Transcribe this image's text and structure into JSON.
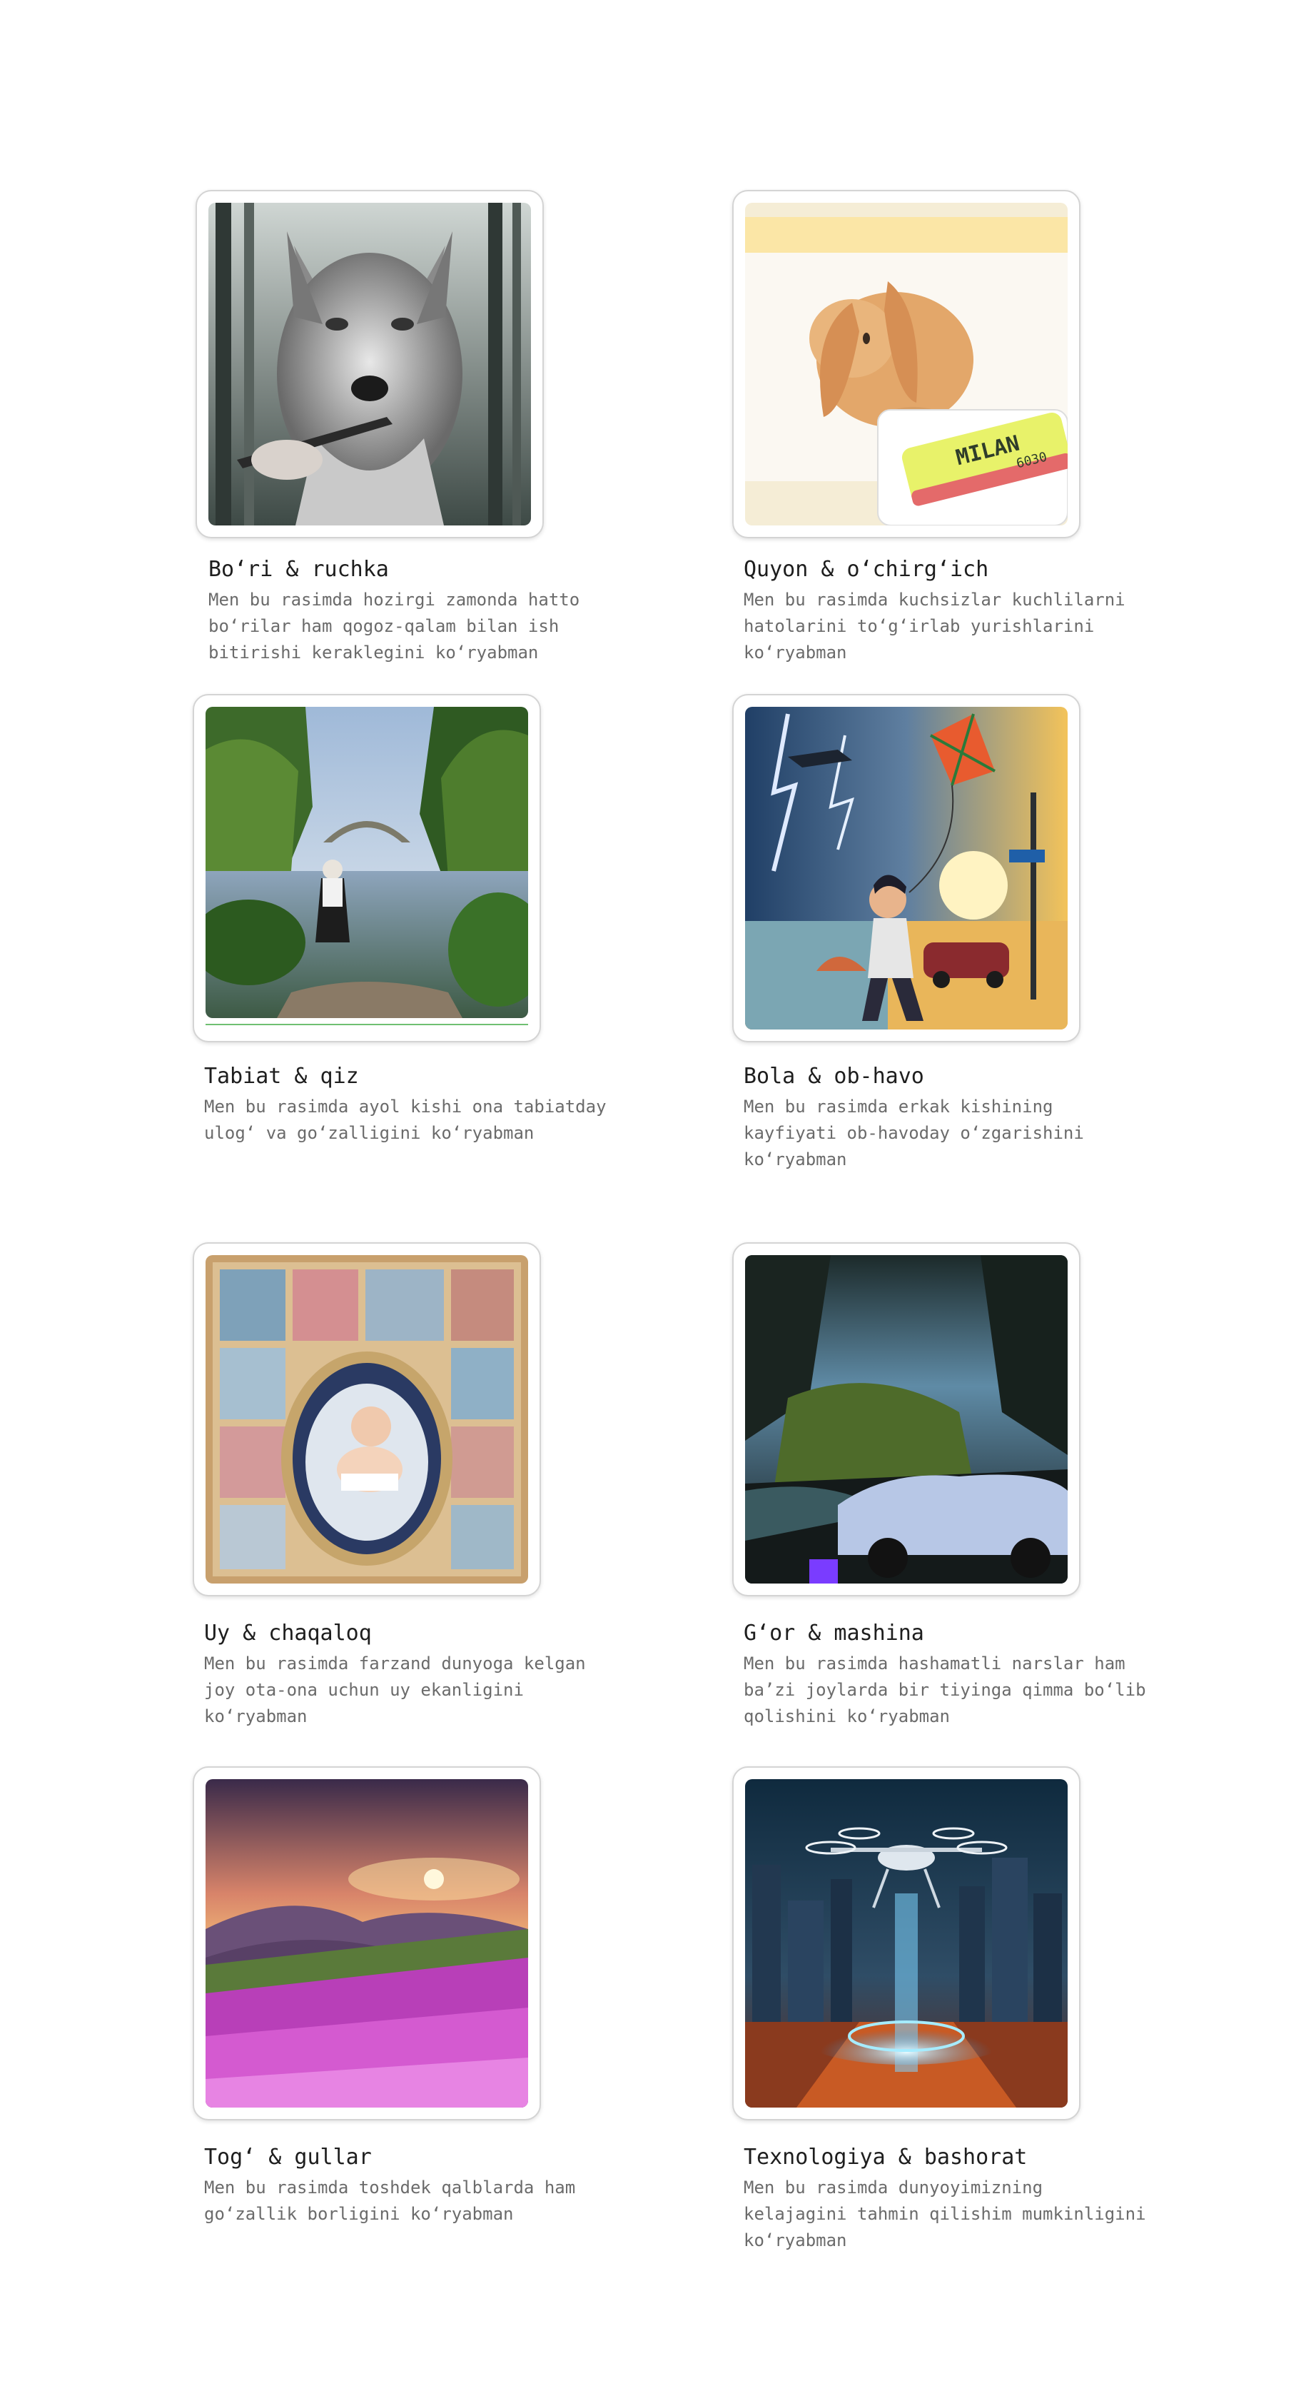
{
  "gallery": {
    "items": [
      {
        "title": "Bo‘ri & ruchka",
        "image_alt": "wolf holding a pen in a forest",
        "desc_lines": [
          "Men bu rasimda hozirgi zamonda hatto",
          "bo‘rilar ham qogoz-qalam bilan ish",
          "bitirishi keraklegini ko‘ryabman"
        ]
      },
      {
        "title": "Quyon & o‘chirg‘ich",
        "image_alt": "rabbit with a Milan eraser",
        "eraser_text": "MILAN",
        "eraser_code": "6030",
        "desc_lines": [
          "Men bu rasimda kuchsizlar kuchlilarni",
          "hatolarini to‘g‘irlab yurishlarini",
          "ko‘ryabman"
        ]
      },
      {
        "title": "Tabiat & qiz",
        "image_alt": "girl standing by a river with stone bridge",
        "desc_lines": [
          "Men bu rasimda ayol kishi ona tabiatday",
          "ulog‘ va go‘zalligini ko‘ryabman"
        ]
      },
      {
        "title": "Bola & ob-havo",
        "image_alt": "boy flying a kite in a storm",
        "desc_lines": [
          "Men bu rasimda erkak kishining",
          "kayfiyati ob-havoday o‘zgarishini",
          "ko‘ryabman"
        ]
      },
      {
        "title": "Uy & chaqaloq",
        "image_alt": "baby in a cradle inside a dollhouse",
        "desc_lines": [
          "Men bu rasimda farzand dunyoga kelgan",
          "joy ota-ona uchun uy ekanligini",
          "ko‘ryabman"
        ]
      },
      {
        "title": "G‘or & mashina",
        "image_alt": "car parked in a mossy cave",
        "desc_lines": [
          "Men bu rasimda hashamatli narslar ham",
          "ba’zi joylarda bir tiyinga qimma bo‘lib",
          "qolishini ko‘ryabman"
        ]
      },
      {
        "title": "Tog‘ & gullar",
        "image_alt": "mountain sunset with pink flowers",
        "desc_lines": [
          "Men bu rasimda toshdek qalblarda ham",
          "go‘zallik borligini ko‘ryabman"
        ]
      },
      {
        "title": "Texnologiya & bashorat",
        "image_alt": "drone over a futuristic city",
        "desc_lines": [
          "Men bu rasimda dunyoyimizning",
          "kelajagini tahmin qilishim mumkinligini",
          "ko‘ryabman"
        ]
      }
    ]
  }
}
